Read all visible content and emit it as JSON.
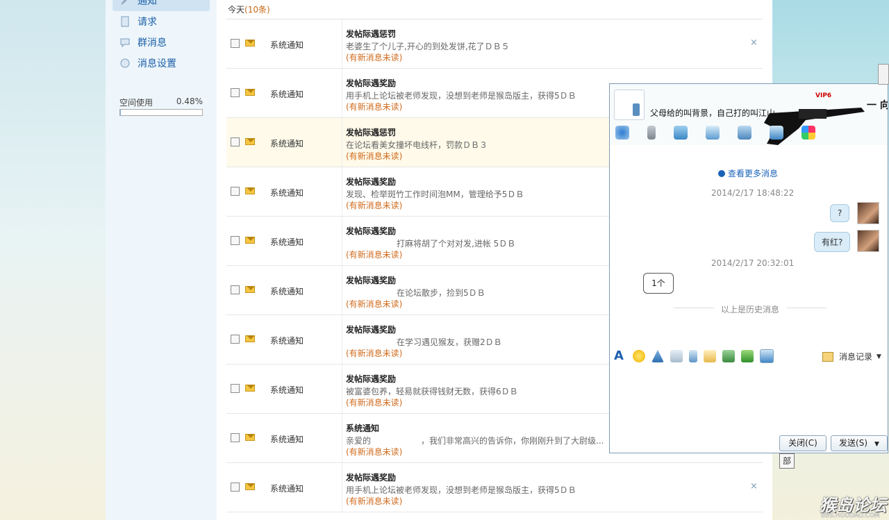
{
  "sidebar": {
    "items": [
      {
        "label": "通知"
      },
      {
        "label": "请求"
      },
      {
        "label": "群消息"
      },
      {
        "label": "消息设置"
      }
    ],
    "space": {
      "label": "空间使用",
      "value": "0.48%",
      "fraction": 0.0048
    }
  },
  "main": {
    "today_label": "今天",
    "today_count": "(10条)",
    "rows": [
      {
        "sender": "系统通知",
        "title": "发帖际遇惩罚",
        "body": "老婆生了个儿子,开心的到处发饼,花了ＤＢ５",
        "unread": "(有新消息未读)"
      },
      {
        "sender": "系统通知",
        "title": "发帖际遇奖励",
        "body": "用手机上论坛被老师发现，没想到老师是猴岛版主，获得5ＤＢ",
        "unread": "(有新消息未读)"
      },
      {
        "sender": "系统通知",
        "title": "发帖际遇惩罚",
        "body": "在论坛看美女撞坏电线杆，罚款ＤＢ３",
        "unread": "(有新消息未读)"
      },
      {
        "sender": "系统通知",
        "title": "发帖际遇奖励",
        "body": "发现、检举斑竹工作时间泡MM，管理给予5ＤＢ",
        "unread": "(有新消息未读)"
      },
      {
        "sender": "系统通知",
        "title": "发帖际遇奖励",
        "body": "打麻将胡了个对对发,进帐 5ＤＢ",
        "unread": "(有新消息未读)"
      },
      {
        "sender": "系统通知",
        "title": "发帖际遇奖励",
        "body": "在论坛散步，捡到5ＤＢ",
        "unread": "(有新消息未读)"
      },
      {
        "sender": "系统通知",
        "title": "发帖际遇奖励",
        "body": "在学习遇见猴友，获赠2ＤＢ",
        "unread": "(有新消息未读)"
      },
      {
        "sender": "系统通知",
        "title": "发帖际遇奖励",
        "body": "被富婆包养，轻易就获得钱财无数，获得6ＤＢ",
        "unread": "(有新消息未读)"
      },
      {
        "sender": "系统通知",
        "title": "系统通知",
        "body": "亲爱的　　　　　　，我们非常高兴的告诉你，你刚刚升到了大尉级...",
        "unread": "(有新消息未读)"
      },
      {
        "sender": "系统通知",
        "title": "发帖际遇奖励",
        "body": "用手机上论坛被老师发现，没想到老师是猴岛版主，获得5ＤＢ",
        "unread": "(有新消息未读)"
      }
    ],
    "delete_glyph": "×"
  },
  "chat": {
    "header_text": "父母给的叫背景，自己打的叫江山",
    "vip": "VIP6",
    "dash_to": "一 向",
    "more_messages": "查看更多消息",
    "ts1": "2014/2/17 18:48:22",
    "bubble1": "?",
    "bubble2": "有红?",
    "ts2": "2014/2/17 20:32:01",
    "bubble3": "1个",
    "history": "以上是历史消息",
    "msg_record": "消息记录",
    "close_btn": "关闭(C)",
    "send_btn": "发送(S)"
  },
  "misc": {
    "bu": "部",
    "watermark": "猴岛论坛",
    "watermark_sub": "BBS.HOUDAO.COM"
  }
}
